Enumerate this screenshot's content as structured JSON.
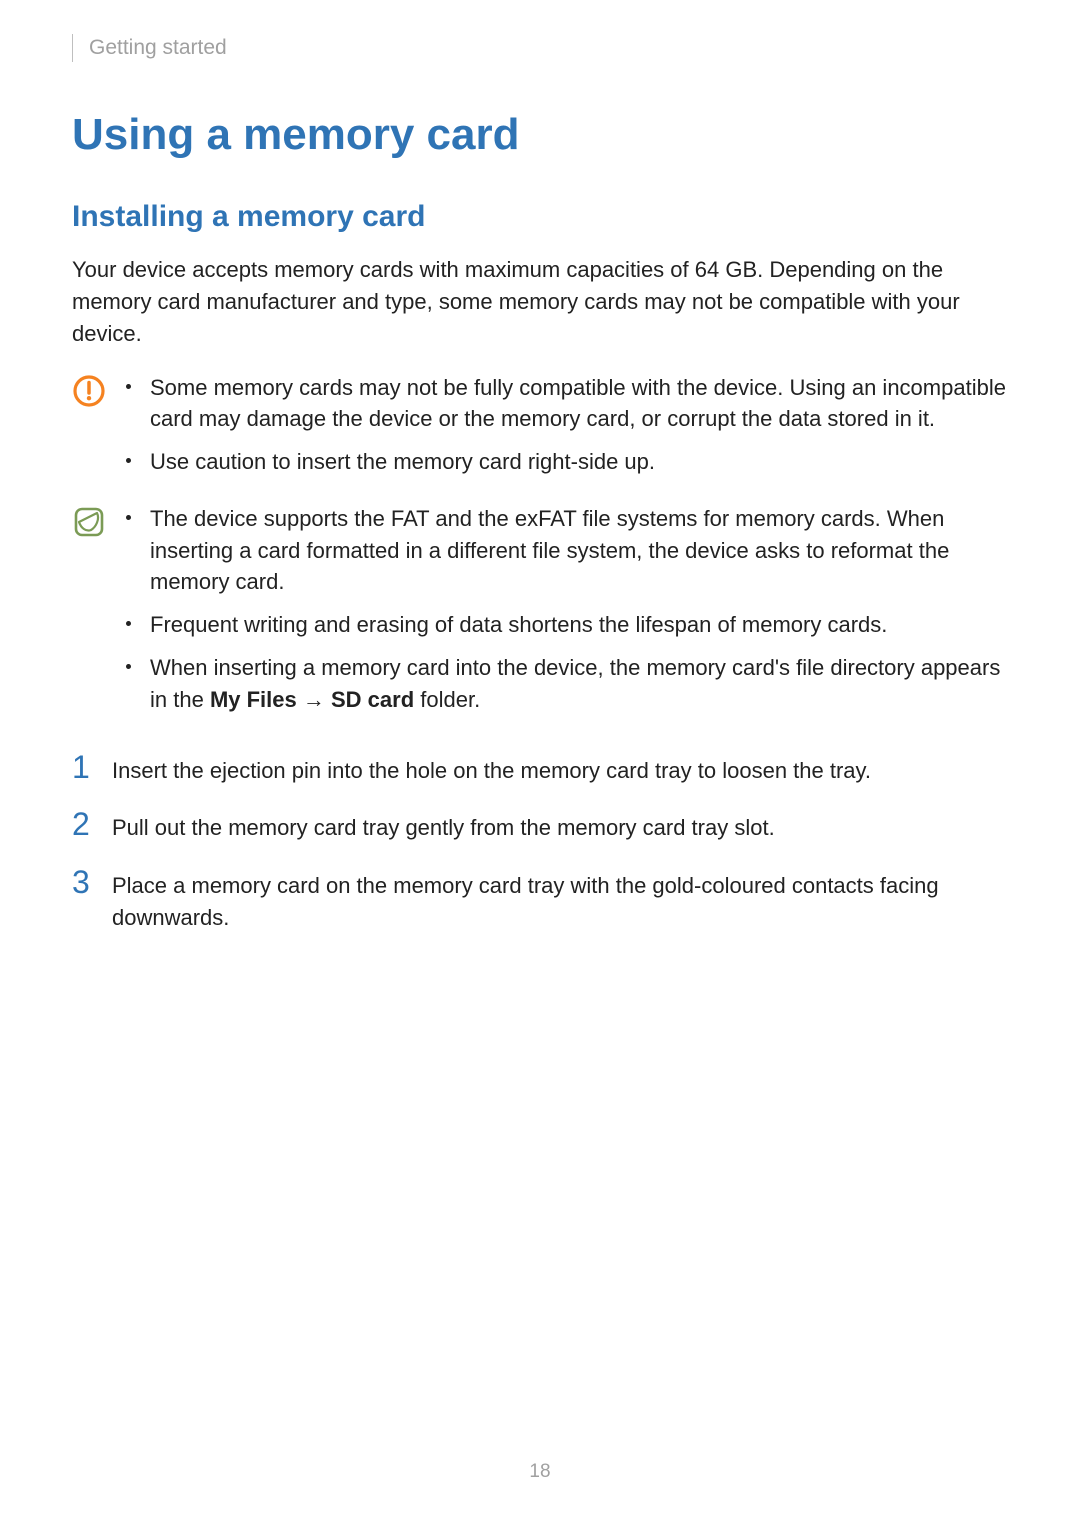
{
  "header": {
    "breadcrumb": "Getting started"
  },
  "title": "Using a memory card",
  "subtitle": "Installing a memory card",
  "intro": "Your device accepts memory cards with maximum capacities of 64 GB. Depending on the memory card manufacturer and type, some memory cards may not be compatible with your device.",
  "caution": {
    "items": [
      "Some memory cards may not be fully compatible with the device. Using an incompatible card may damage the device or the memory card, or corrupt the data stored in it.",
      "Use caution to insert the memory card right-side up."
    ]
  },
  "note": {
    "items": [
      "The device supports the FAT and the exFAT file systems for memory cards. When inserting a card formatted in a different file system, the device asks to reformat the memory card.",
      "Frequent writing and erasing of data shortens the lifespan of memory cards.",
      {
        "pre": "When inserting a memory card into the device, the memory card's file directory appears in the ",
        "b1": "My Files",
        "mid": " → ",
        "b2": "SD card",
        "post": " folder."
      }
    ]
  },
  "steps": [
    {
      "n": "1",
      "text": "Insert the ejection pin into the hole on the memory card tray to loosen the tray."
    },
    {
      "n": "2",
      "text": "Pull out the memory card tray gently from the memory card tray slot."
    },
    {
      "n": "3",
      "text": "Place a memory card on the memory card tray with the gold-coloured contacts facing downwards."
    }
  ],
  "pageNumber": "18"
}
